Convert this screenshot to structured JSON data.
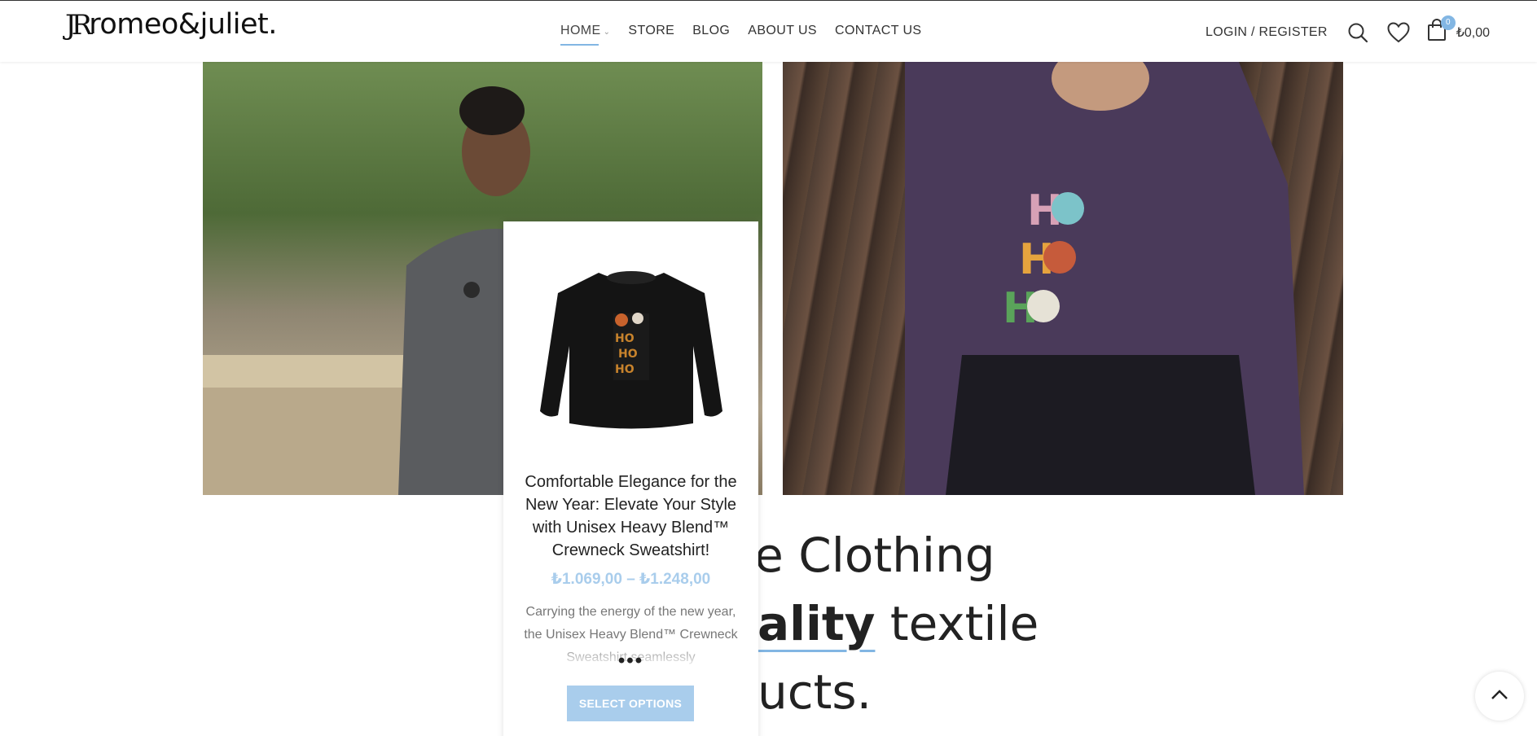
{
  "brand": {
    "logo_mark": "JR",
    "logo_text": "romeo&juliet."
  },
  "nav": {
    "items": [
      {
        "label": "HOME",
        "active": true,
        "has_dropdown": true
      },
      {
        "label": "STORE"
      },
      {
        "label": "BLOG"
      },
      {
        "label": "ABOUT US"
      },
      {
        "label": "CONTACT US"
      }
    ]
  },
  "header_actions": {
    "login_label": "LOGIN / REGISTER",
    "search_icon": "search-icon",
    "wishlist_icon": "heart-icon",
    "cart_icon": "shopping-bag-icon",
    "cart_count": "0",
    "cart_total": "₺0,00"
  },
  "headline": {
    "line1": "le Clothing",
    "line2_bold": "ality",
    "line2_rest": " textile",
    "line3": "ucts."
  },
  "product_card": {
    "title": "Comfortable Elegance for the New Year: Elevate Your Style with Unisex Heavy Blend™ Crewneck Sweatshirt!",
    "price": "₺1.069,00 – ₺1.248,00",
    "description": "Carrying the energy of the new year, the Unisex Heavy Blend™ Crewneck Sweatshirt seamlessly",
    "more": "•••",
    "button_label": "SELECT OPTIONS"
  },
  "colors": {
    "accent": "#82b6e3",
    "price": "#a9cdec",
    "button": "#a9cdec"
  }
}
